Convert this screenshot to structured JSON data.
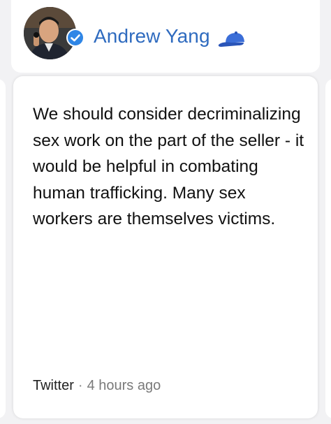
{
  "header": {
    "display_name": "Andrew Yang",
    "verified_icon": "verified-badge-icon",
    "emoji_icon": "blue-cap-icon"
  },
  "card": {
    "text": "We should consider decriminalizing sex work on the part of the seller - it would be helpful in combating human trafficking. Many sex workers are themselves victims.",
    "source": "Twitter",
    "separator": "·",
    "time": "4 hours ago"
  },
  "colors": {
    "name": "#2f6bbf",
    "verified": "#2f86e6",
    "cap": "#3b6ed8"
  }
}
